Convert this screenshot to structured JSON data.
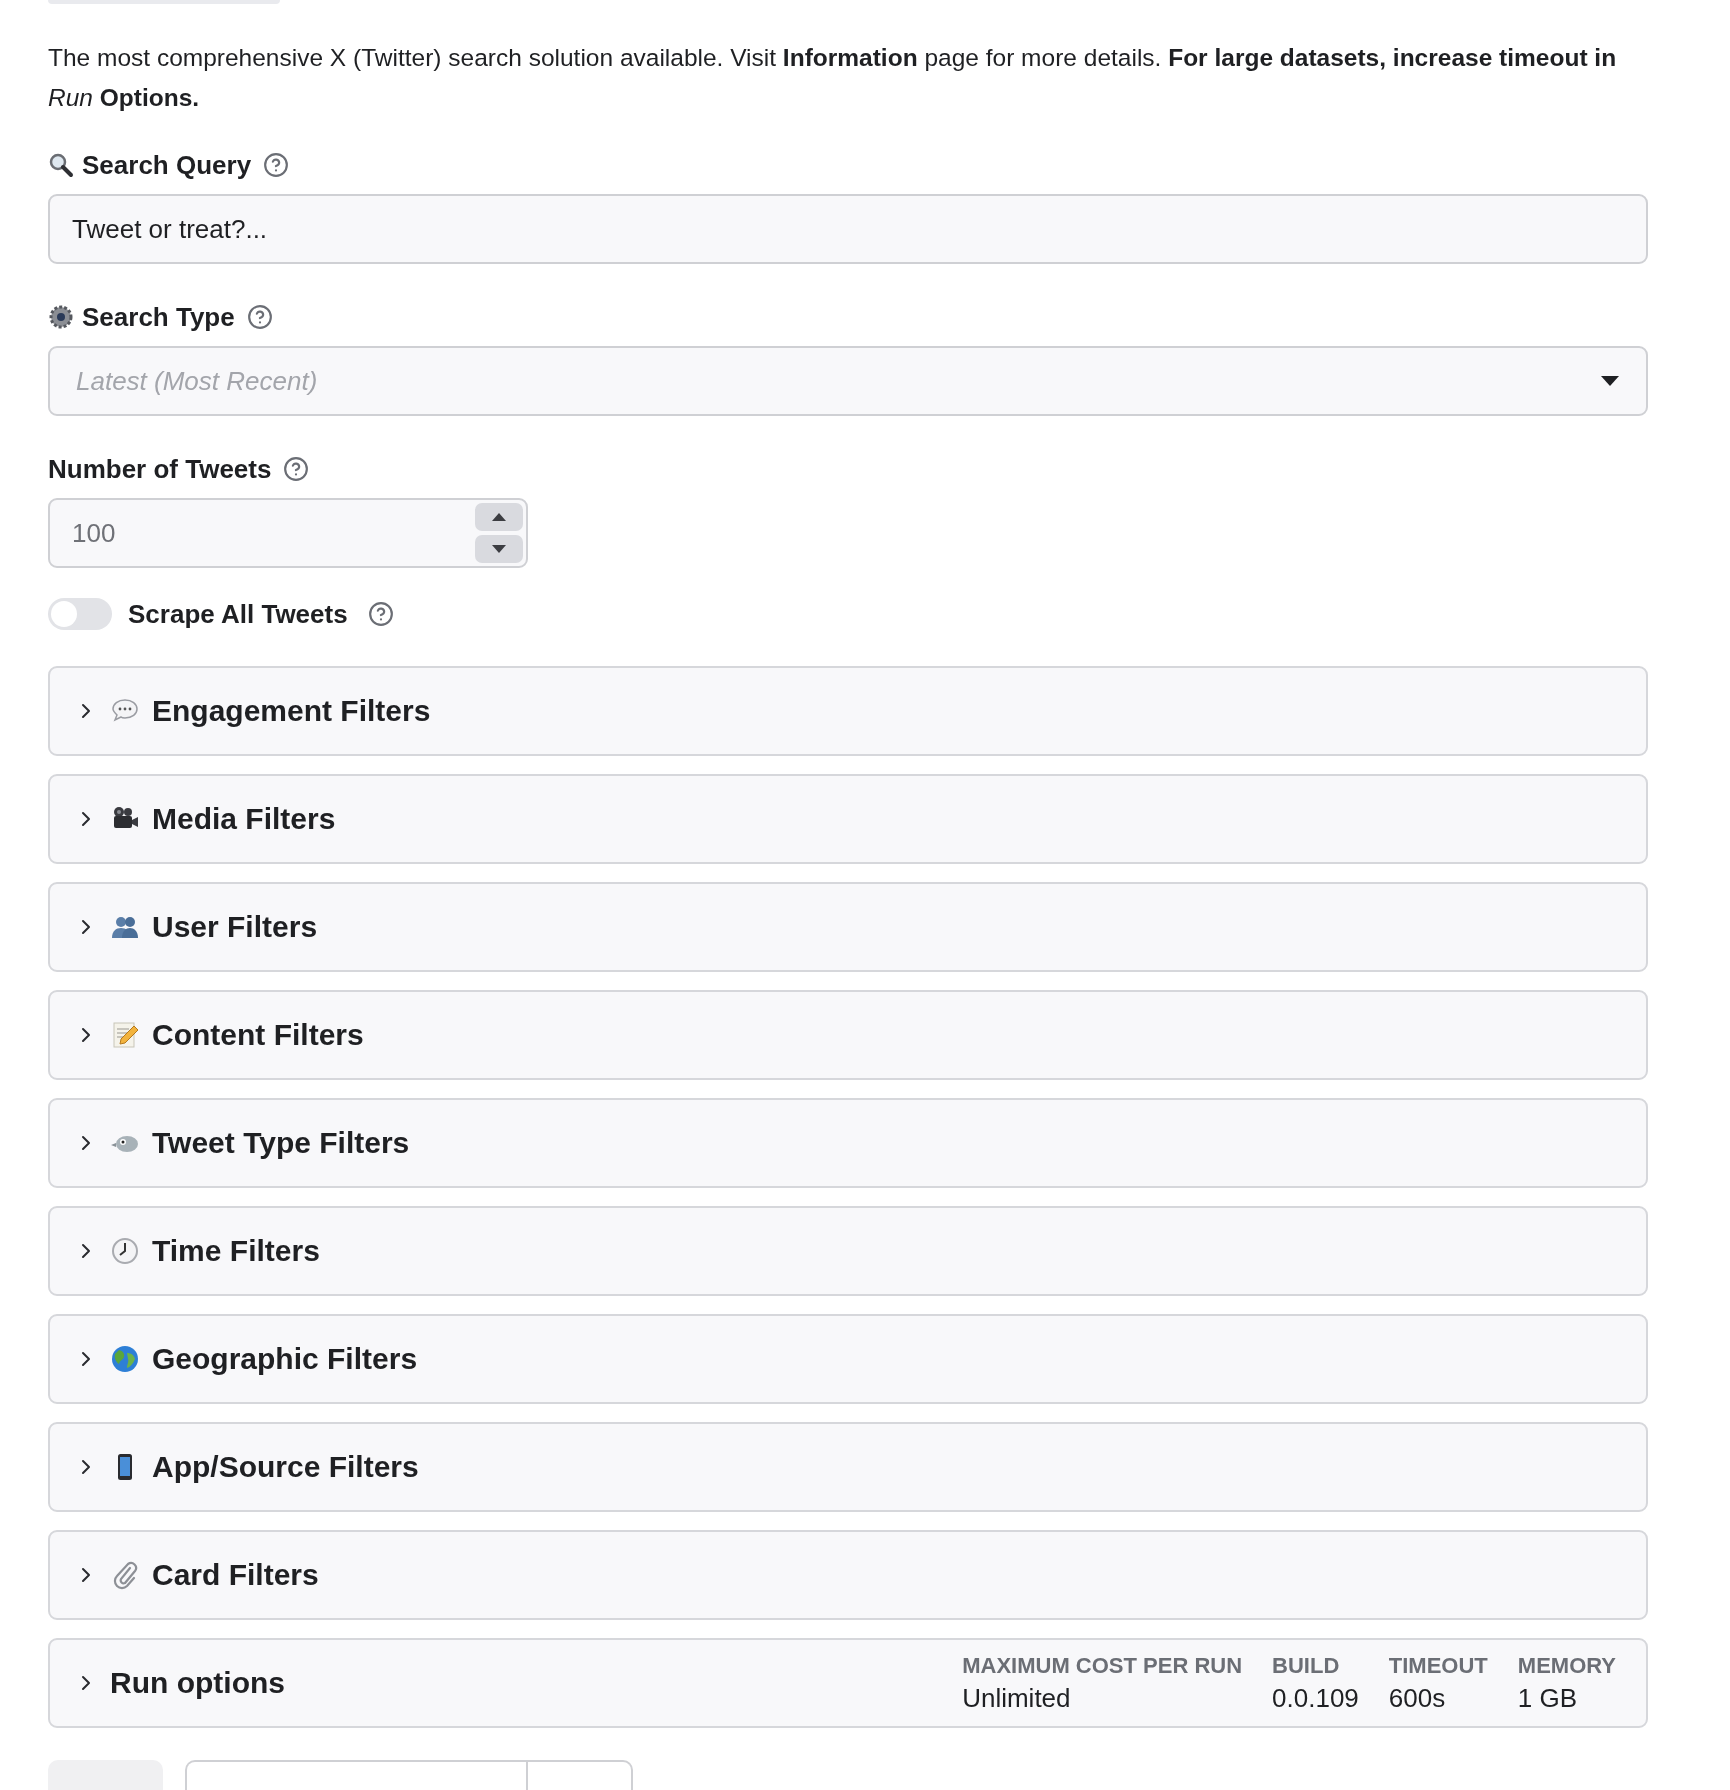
{
  "description": "The most comprehensive X (Twitter) search solution available. Visit **Information** page for more details. **For large datasets, increase timeout in** *Run* **Options.**",
  "fields": [
    {
      "kind": "text",
      "label": "Search Query",
      "value": "Tweet or treat?..."
    },
    {
      "kind": "select",
      "label": "Search Type",
      "placeholder": "Latest (Most Recent)"
    },
    {
      "kind": "number",
      "label": "Number of Tweets",
      "placeholder": "100"
    },
    {
      "kind": "toggle",
      "label": "Scrape All Tweets",
      "on": false
    }
  ],
  "sections": [
    {
      "title": "Engagement Filters",
      "expanded": false
    },
    {
      "title": "Media Filters",
      "expanded": false
    },
    {
      "title": "User Filters",
      "expanded": false
    },
    {
      "title": "Content Filters",
      "expanded": false
    },
    {
      "title": "Tweet Type Filters",
      "expanded": false
    },
    {
      "title": "Time Filters",
      "expanded": false
    },
    {
      "title": "Geographic Filters",
      "expanded": false
    },
    {
      "title": "App/Source Filters",
      "expanded": false
    },
    {
      "title": "Card Filters",
      "expanded": false
    }
  ],
  "run_options": {
    "title": "Run options",
    "expanded": false,
    "stats": [
      {
        "label": "MAXIMUM COST PER RUN",
        "value": "Unlimited"
      },
      {
        "label": "BUILD",
        "value": "0.0.109"
      },
      {
        "label": "TIMEOUT",
        "value": "600s"
      },
      {
        "label": "MEMORY",
        "value": "1 GB"
      }
    ]
  }
}
